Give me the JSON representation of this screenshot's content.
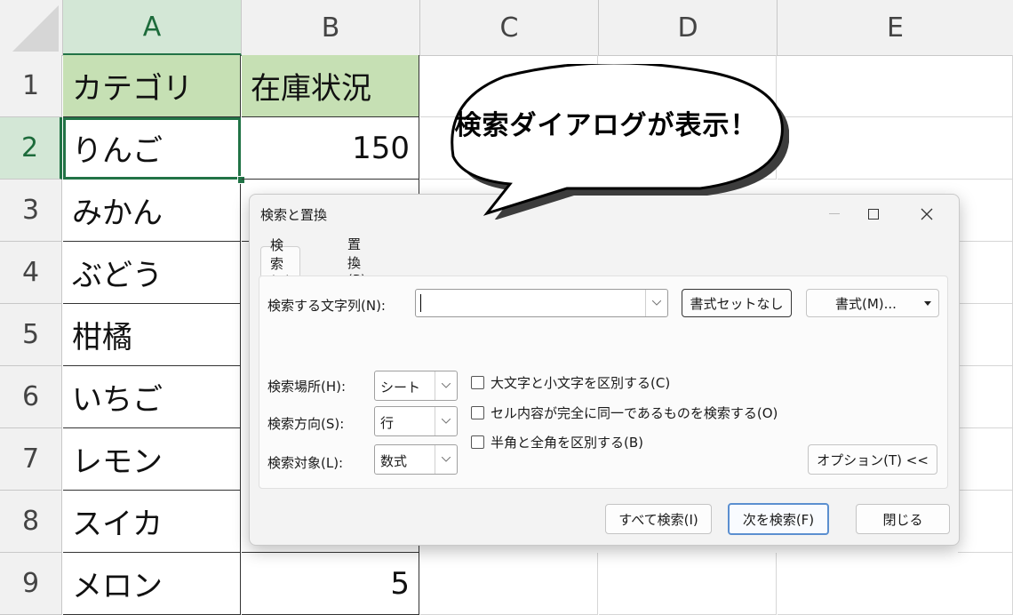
{
  "sheet": {
    "columns": [
      "A",
      "B",
      "C",
      "D",
      "E"
    ],
    "rows": [
      "1",
      "2",
      "3",
      "4",
      "5",
      "6",
      "7",
      "8",
      "9"
    ],
    "colA": [
      "カテゴリ",
      "りんご",
      "みかん",
      "ぶどう",
      "柑橘",
      "いちご",
      "レモン",
      "スイカ",
      "メロン"
    ],
    "colB": [
      "在庫状況",
      "150",
      "",
      "",
      "",
      "",
      "",
      "",
      "5"
    ],
    "colors": {
      "header_fill": "#c6e0b4",
      "selection": "#217346"
    }
  },
  "callout": {
    "text": "検索ダイアログが表示！"
  },
  "dialog": {
    "title": "検索と置換",
    "tabs": {
      "find": "検索(D)",
      "replace": "置換(P)"
    },
    "find_label": "検索する文字列(N):",
    "find_value": "",
    "no_format_button": "書式セットなし",
    "format_button": "書式(M)...",
    "within_label": "検索場所(H):",
    "within_value": "シート",
    "search_label": "検索方向(S):",
    "search_value": "行",
    "lookin_label": "検索対象(L):",
    "lookin_value": "数式",
    "match_case": "大文字と小文字を区別する(C)",
    "match_entire": "セル内容が完全に同一であるものを検索する(O)",
    "match_byte": "半角と全角を区別する(B)",
    "options_button": "オプション(T) <<",
    "find_all_button": "すべて検索(I)",
    "find_next_button": "次を検索(F)",
    "close_button": "閉じる"
  }
}
